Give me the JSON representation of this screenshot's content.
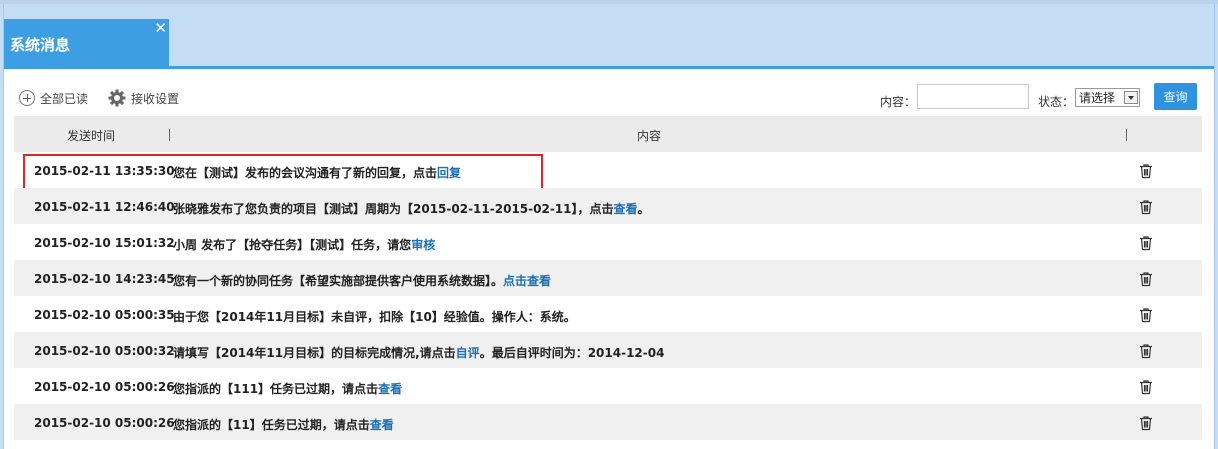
{
  "tab": {
    "title": "系统消息",
    "close": "✕"
  },
  "toolbar": {
    "mark_all_read": "全部已读",
    "receive_settings": "接收设置"
  },
  "filter": {
    "content_label": "内容：",
    "content_value": "",
    "status_label": "状态：",
    "status_selected": "请选择",
    "query_button": "查询"
  },
  "table": {
    "headers": {
      "time": "发送时间",
      "content": "内容"
    },
    "rows": [
      {
        "time": "2015-02-11 13:35:30",
        "text": "您在【测试】发布的会议沟通有了新的回复，点击",
        "link": "回复",
        "suffix": ""
      },
      {
        "time": "2015-02-11 12:46:40",
        "text": "张晓雅发布了您负责的项目【测试】周期为【2015-02-11-2015-02-11】，点击",
        "link": "查看",
        "suffix": "。"
      },
      {
        "time": "2015-02-10 15:01:32",
        "text": "小周 发布了【抢夺任务】【测试】任务，请您",
        "link": "审核",
        "suffix": ""
      },
      {
        "time": "2015-02-10 14:23:45",
        "text": "您有一个新的协同任务【希望实施部提供客户使用系统数据】。",
        "link": "点击查看",
        "suffix": ""
      },
      {
        "time": "2015-02-10 05:00:35",
        "text": "由于您【2014年11月目标】未自评，扣除【10】经验值。操作人：系统。",
        "link": "",
        "suffix": ""
      },
      {
        "time": "2015-02-10 05:00:32",
        "text": "请填写【2014年11月目标】的目标完成情况,请点击",
        "link": "自评",
        "suffix": "。最后自评时间为：2014-12-04"
      },
      {
        "time": "2015-02-10 05:00:26",
        "text": "您指派的【111】任务已过期，请点击",
        "link": "查看",
        "suffix": ""
      },
      {
        "time": "2015-02-10 05:00:26",
        "text": "您指派的【11】任务已过期，请点击",
        "link": "查看",
        "suffix": ""
      }
    ]
  },
  "colors": {
    "accent": "#3d9ee4",
    "link": "#1b6fb5",
    "highlight": "#e0262c",
    "background": "#c5dcf5"
  },
  "icons": {
    "mark_all_read": "plus-circle-icon",
    "receive_settings": "gear-icon",
    "delete": "trash-icon"
  }
}
